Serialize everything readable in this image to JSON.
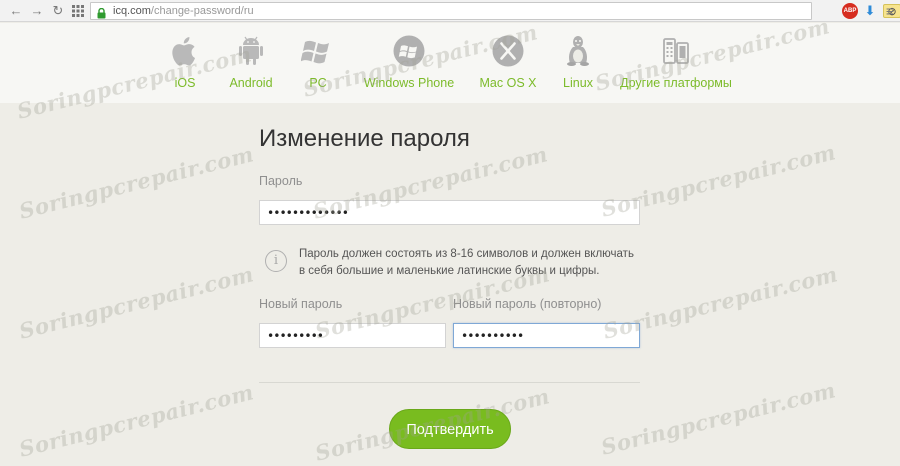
{
  "browser": {
    "url_host": "icq.com",
    "url_path": "/change-password/ru",
    "adblock_label": "ABP"
  },
  "platforms": [
    {
      "label": "iOS",
      "icon": "apple-icon"
    },
    {
      "label": "Android",
      "icon": "android-icon"
    },
    {
      "label": "PC",
      "icon": "windows-icon"
    },
    {
      "label": "Windows Phone",
      "icon": "windows-phone-icon"
    },
    {
      "label": "Mac OS X",
      "icon": "mac-os-x-icon"
    },
    {
      "label": "Linux",
      "icon": "linux-icon"
    },
    {
      "label": "Другие платформы",
      "icon": "other-platforms-icon"
    }
  ],
  "form": {
    "title": "Изменение пароля",
    "password_label": "Пароль",
    "password_value": "•••••••••••••",
    "hint_icon_glyph": "i",
    "hint": "Пароль должен состоять из 8-16 символов и должен включать в себя большие и маленькие латинские буквы и цифры.",
    "new_password_label": "Новый пароль",
    "new_password_value": "•••••••••",
    "repeat_password_label": "Новый пароль (повторно)",
    "repeat_password_value": "••••••••••",
    "submit_label": "Подтвердить"
  },
  "watermark_text": "Soringpcrepair.com",
  "colors": {
    "accent_green": "#7cbb2a",
    "button_green": "#79bc1f",
    "background": "#eeede7"
  }
}
